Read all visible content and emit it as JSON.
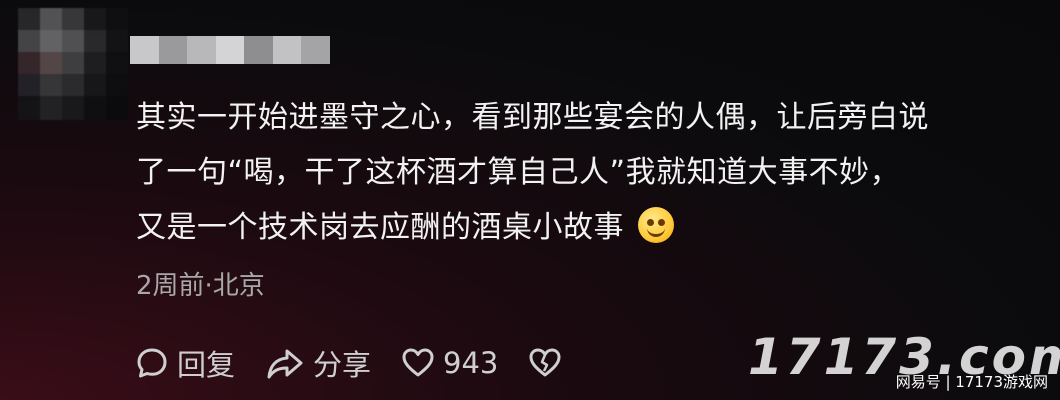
{
  "comment": {
    "line1": "其实一开始进墨守之心，看到那些宴会的人偶，让后旁白说",
    "line2": "了一句“喝，干了这杯酒才算自己人”我就知道大事不妙，",
    "line3": "又是一个技术岗去应酬的酒桌小故事",
    "emoji": "smile-emoji"
  },
  "meta": {
    "time_location": "2周前·北京"
  },
  "actions": {
    "reply_label": "回复",
    "share_label": "分享",
    "like_count": "943"
  },
  "watermark": {
    "text": "17173.com",
    "source": "网易号 | 17173游戏网"
  },
  "colors": {
    "text": "#f2f2f2",
    "meta": "#a8a8aa",
    "background": "#09090b",
    "glow": "#3a0d18"
  }
}
